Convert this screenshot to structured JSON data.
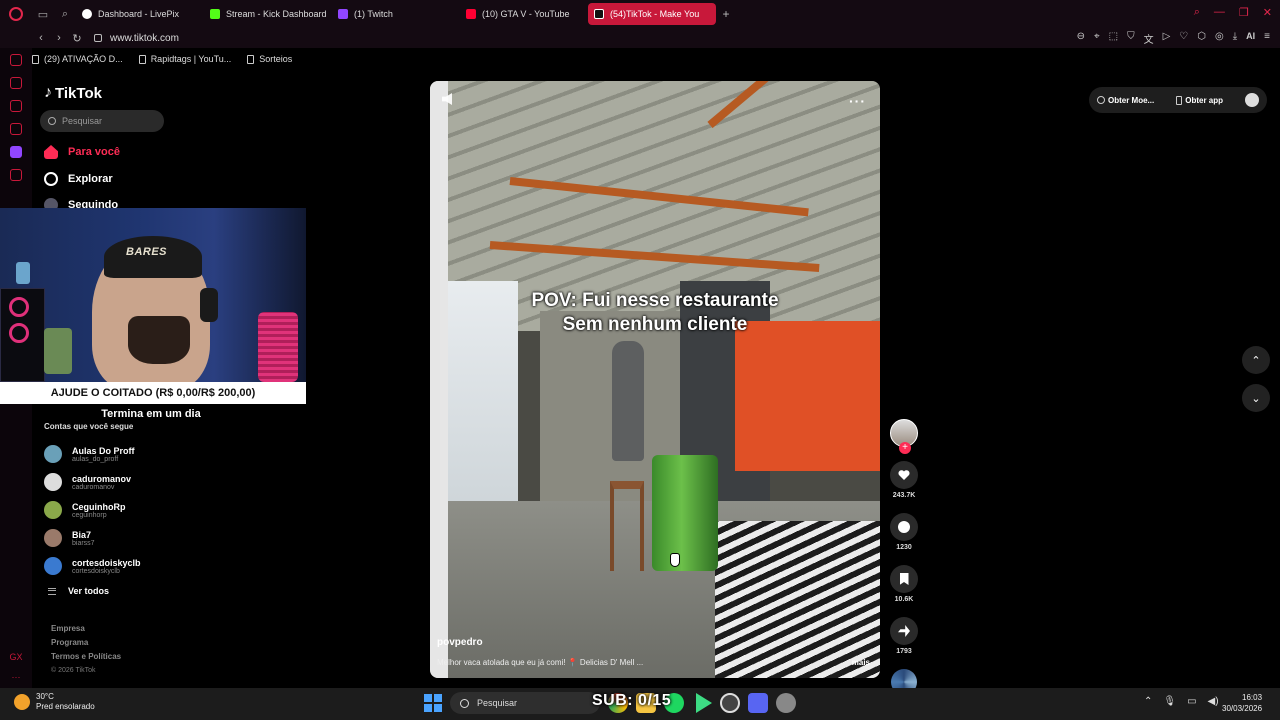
{
  "browser": {
    "tabs": [
      {
        "label": "Dashboard - LivePix",
        "color": "#ffffff"
      },
      {
        "label": "Stream - Kick Dashboard",
        "color": "#53fc18"
      },
      {
        "label": "(1) Twitch",
        "color": "#9146ff"
      },
      {
        "label": "(10) GTA V - YouTube",
        "color": "#ff0033"
      },
      {
        "label": "(54)TikTok - Make You",
        "color": "#ffffff",
        "active": true
      }
    ],
    "url": "www.tiktok.com",
    "ai_label": "AI",
    "bookmarks": [
      "(29) ATIVAÇÃO D...",
      "Rapidtags | YouTu...",
      "Sorteios"
    ]
  },
  "tiktok": {
    "logo_text": "TikTok",
    "search_placeholder": "Pesquisar",
    "nav": {
      "for_you": "Para você",
      "explore": "Explorar",
      "following": "Seguindo"
    },
    "following_header": "Contas que você segue",
    "accounts": [
      {
        "name": "Aulas Do Proff",
        "handle": "aulas_do_proff",
        "color": "#6aa0b8"
      },
      {
        "name": "caduromanov",
        "handle": "caduromanov",
        "color": "#dddddd"
      },
      {
        "name": "CeguinhoRp",
        "handle": "ceguinhorp",
        "color": "#8aa84a"
      },
      {
        "name": "Bia7",
        "handle": "biarss7",
        "color": "#9a7a6a"
      },
      {
        "name": "cortesdoiskyclb",
        "handle": "cortesdoiskyclb",
        "color": "#3a7ad0"
      }
    ],
    "see_all": "Ver todos",
    "footer": {
      "company": "Empresa",
      "program": "Programa",
      "terms": "Termos e Políticas",
      "copyright": "© 2026 TikTok"
    },
    "top_right": {
      "coins": "Obter Moe...",
      "get_app": "Obter app"
    },
    "video": {
      "caption_line1": "POV: Fui nesse restaurante",
      "caption_line2": "Sem nenhum cliente",
      "author": "povpedro",
      "description": "Melhor vaca atolada que eu já comi! 📍 Delicias D' Mell ...",
      "more": "mais",
      "likes": "243.7K",
      "comments": "1230",
      "saves": "10.6K",
      "shares": "1793"
    }
  },
  "stream_overlay": {
    "cap_text": "BARES",
    "goal": "AJUDE O COITADO (R$ 0,00/R$ 200,00)",
    "goal_end": "Termina em um dia",
    "sub_counter": "SUB: 0/15"
  },
  "taskbar": {
    "temp": "30°C",
    "weather": "Pred ensolarado",
    "search": "Pesquisar",
    "time": "16:03",
    "date": "30/03/2026"
  }
}
